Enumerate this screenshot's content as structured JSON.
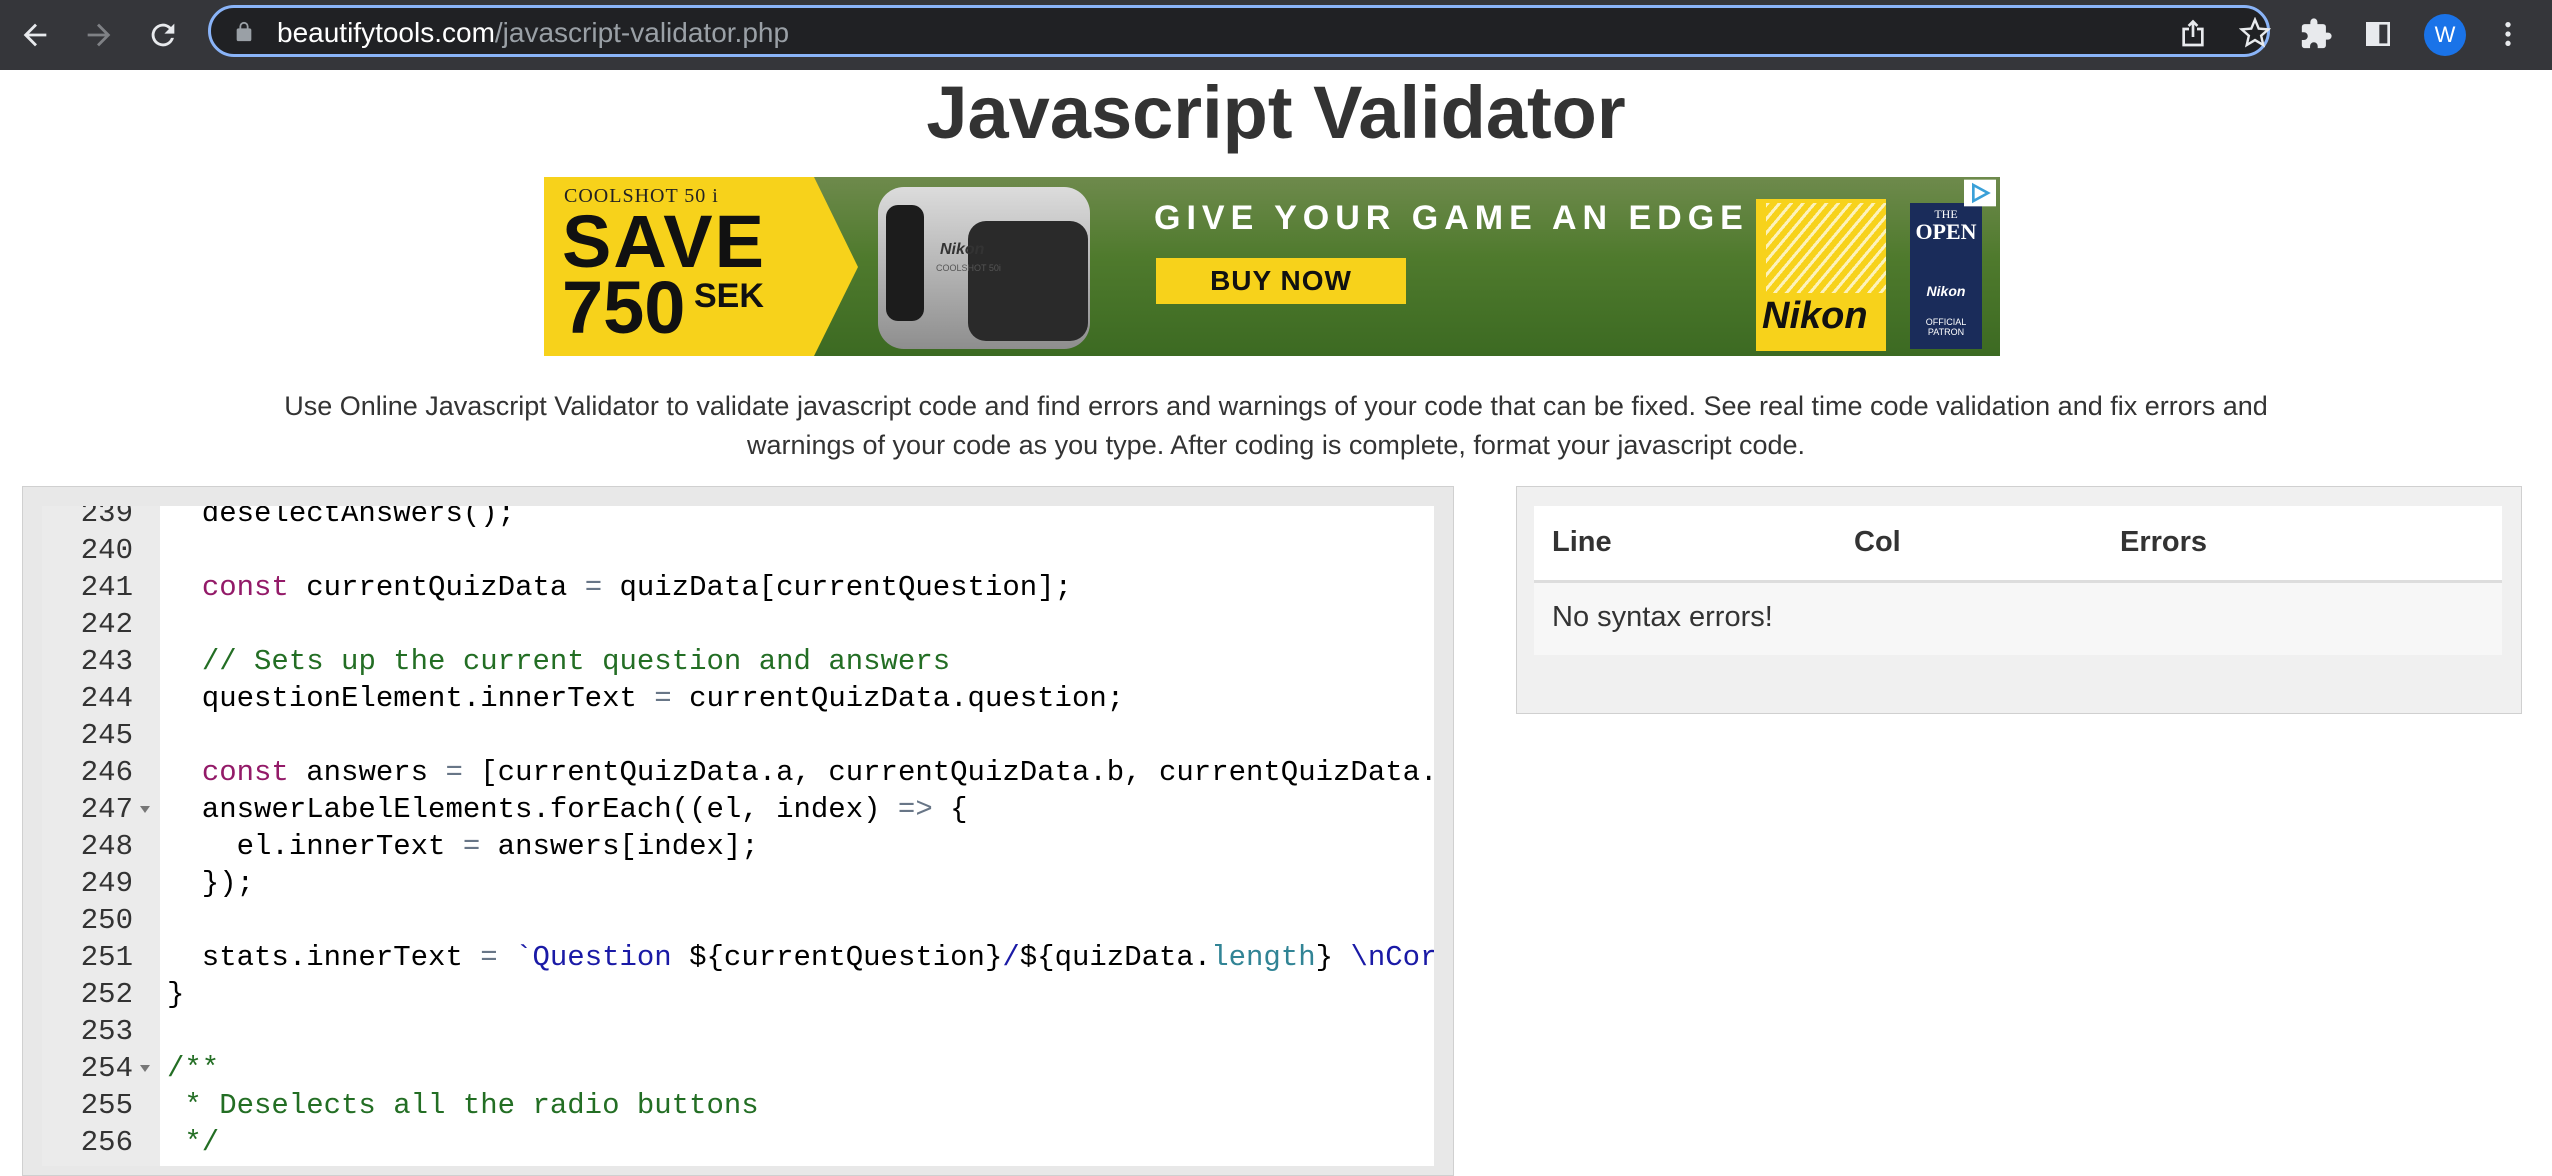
{
  "browser": {
    "url_host": "beautifytools.com",
    "url_path": "/javascript-validator.php",
    "profile_initial": "W"
  },
  "page": {
    "title": "Javascript Validator",
    "description": "Use Online Javascript Validator to validate javascript code and find errors and warnings of your code that can be fixed. See real time code validation and fix errors and warnings of your code as you type. After coding is complete, format your javascript code."
  },
  "ad": {
    "product": "COOLSHOT 50 i",
    "save": "SAVE",
    "amount": "750",
    "currency": "SEK",
    "device_brand": "Nikon",
    "device_model": "COOLSHOT 50i",
    "headline": "GIVE YOUR GAME AN EDGE",
    "cta": "BUY NOW",
    "brand": "Nikon",
    "open_the": "THE",
    "open_open": "OPEN",
    "open_nikon": "Nikon",
    "open_patron": "OFFICIAL PATRON"
  },
  "editor": {
    "lines": [
      {
        "n": "239",
        "html": "  deselectAnswers();",
        "fold": false
      },
      {
        "n": "240",
        "html": "",
        "fold": false
      },
      {
        "n": "241",
        "html": "  <span class=\"kw\">const</span> currentQuizData <span class=\"op\">=</span> quizData[currentQuestion];",
        "fold": false
      },
      {
        "n": "242",
        "html": "",
        "fold": false
      },
      {
        "n": "243",
        "html": "  <span class=\"cm\">// Sets up the current question and answers</span>",
        "fold": false
      },
      {
        "n": "244",
        "html": "  questionElement.innerText <span class=\"op\">=</span> currentQuizData.question;",
        "fold": false
      },
      {
        "n": "245",
        "html": "",
        "fold": false
      },
      {
        "n": "246",
        "html": "  <span class=\"kw\">const</span> answers <span class=\"op\">=</span> [currentQuizData.a, currentQuizData.b, currentQuizData.c];",
        "fold": false
      },
      {
        "n": "247",
        "html": "  answerLabelElements.forEach((el, index) <span class=\"op\">=&gt;</span> {",
        "fold": true
      },
      {
        "n": "248",
        "html": "    el.innerText <span class=\"op\">=</span> answers[index];",
        "fold": false
      },
      {
        "n": "249",
        "html": "  });",
        "fold": false
      },
      {
        "n": "250",
        "html": "",
        "fold": false
      },
      {
        "n": "251",
        "html": "  stats.innerText <span class=\"op\">=</span> <span class=\"str\">`Question </span>${currentQuestion}<span class=\"str\">/</span>${quizData.<span class=\"prop\">length</span>} <span class=\"str\">\\nCorrect answers: </span>${score}<span class=\"str\">`</span>;",
        "fold": false
      },
      {
        "n": "252",
        "html": "}",
        "fold": false
      },
      {
        "n": "253",
        "html": "",
        "fold": false
      },
      {
        "n": "254",
        "html": "<span class=\"cm\">/**</span>",
        "fold": true
      },
      {
        "n": "255",
        "html": "<span class=\"cm\"> * Deselects all the radio buttons</span>",
        "fold": false
      },
      {
        "n": "256",
        "html": "<span class=\"cm\"> */</span>",
        "fold": false
      }
    ]
  },
  "results": {
    "columns": [
      "Line",
      "Col",
      "Errors"
    ],
    "message": "No syntax errors!"
  }
}
